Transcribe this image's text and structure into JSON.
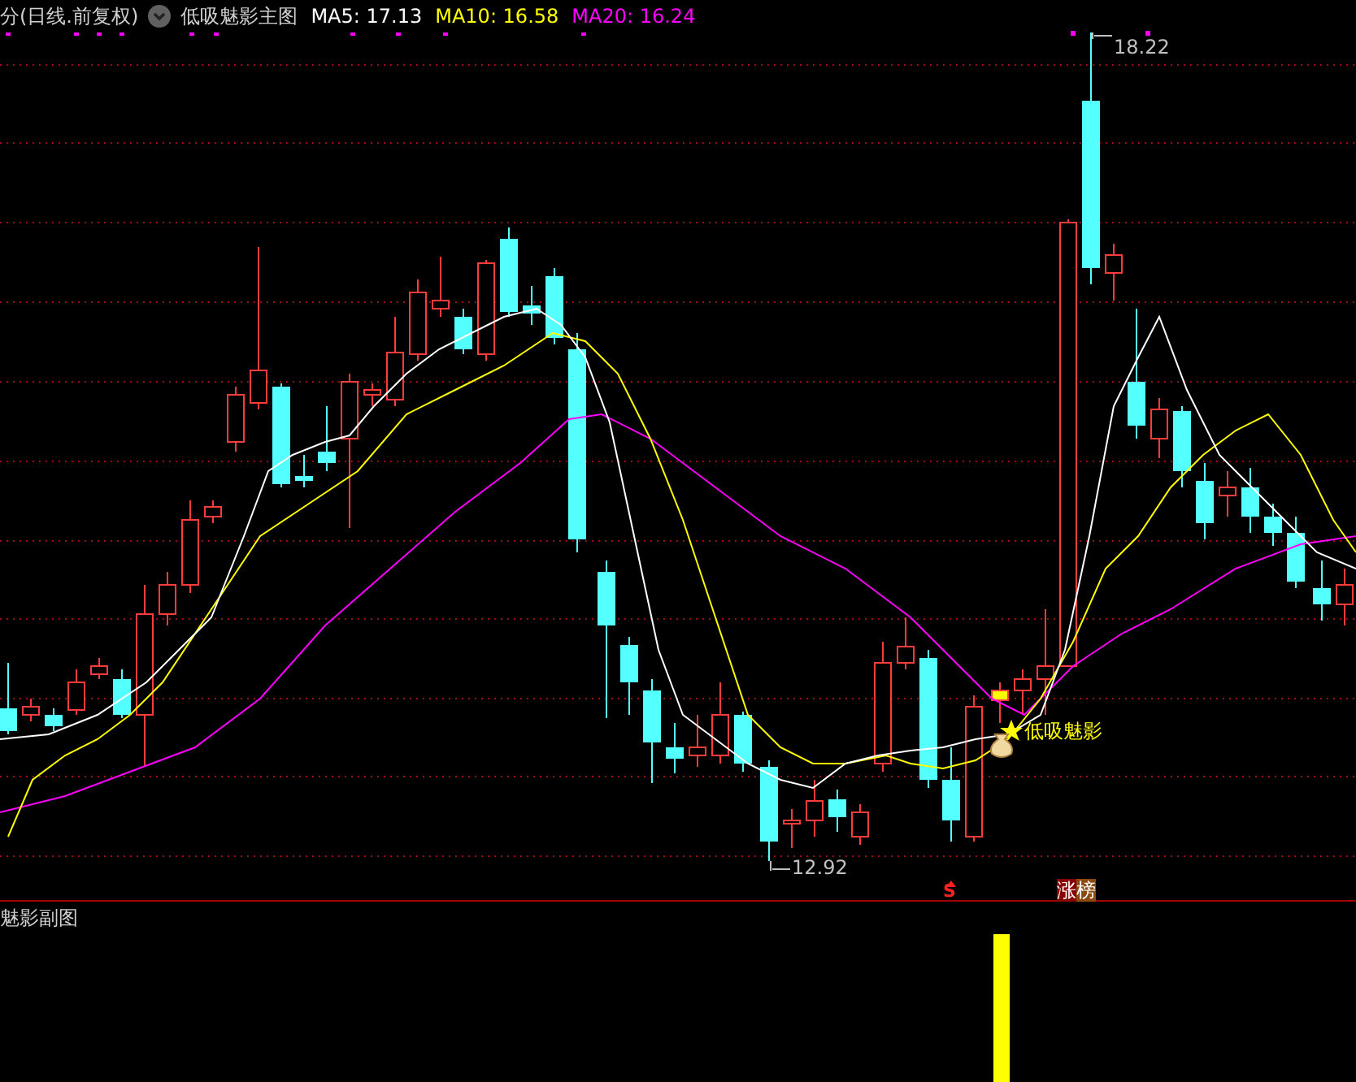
{
  "header": {
    "period": "分(日线.前复权)",
    "indicator": "低吸魅影主图",
    "ma": [
      {
        "label": "MA5: 17.13",
        "color": "#ffffff"
      },
      {
        "label": "MA10: 16.58",
        "color": "#ffff00"
      },
      {
        "label": "MA20: 16.24",
        "color": "#ff00ff"
      }
    ]
  },
  "main_chart": {
    "high_label": "18.22",
    "low_label": "12.92",
    "signal_label": "低吸魅影",
    "sell_mark": "S",
    "rank_tag": "涨榜"
  },
  "sub_chart": {
    "title": "魅影副图"
  }
}
